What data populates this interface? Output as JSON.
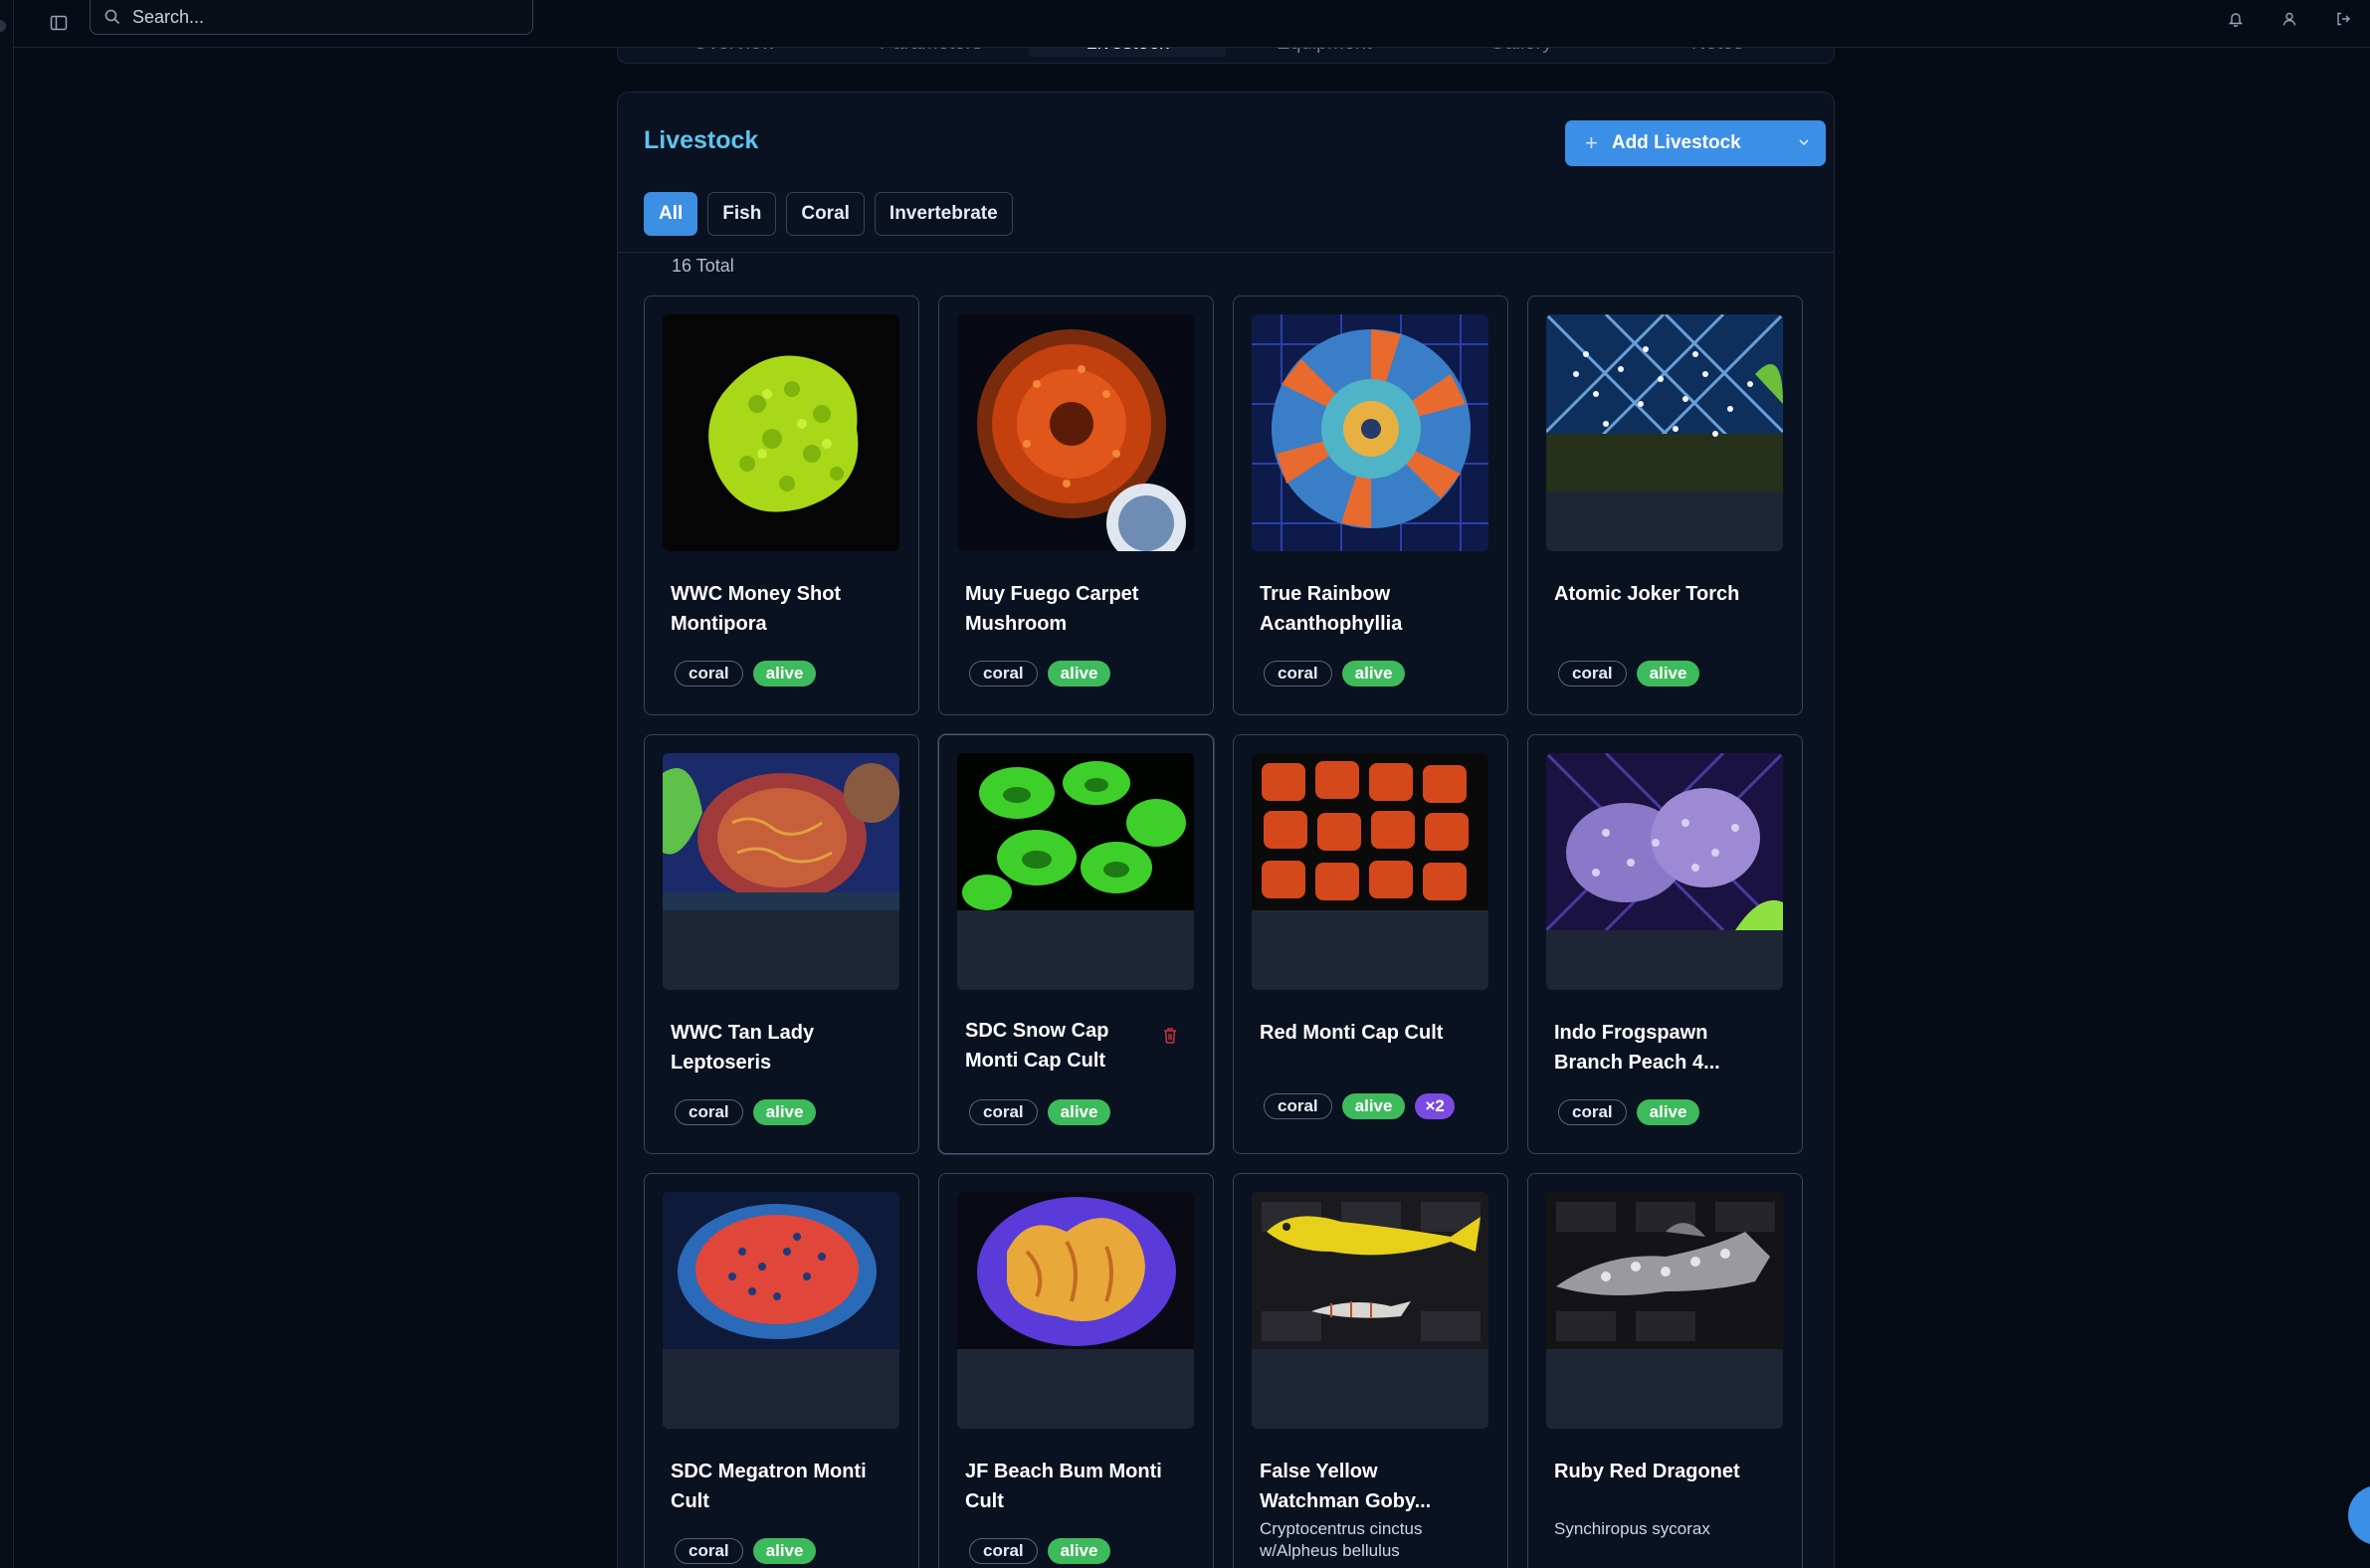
{
  "search": {
    "placeholder": "Search..."
  },
  "tabs": [
    {
      "label": "Overview",
      "active": false
    },
    {
      "label": "Parameters",
      "active": false
    },
    {
      "label": "Livestock",
      "active": true
    },
    {
      "label": "Equipment",
      "active": false
    },
    {
      "label": "Gallery",
      "active": false
    },
    {
      "label": "Notes",
      "active": false
    }
  ],
  "livestock": {
    "title": "Livestock",
    "add_label": "Add Livestock",
    "filters": [
      {
        "label": "All",
        "active": true
      },
      {
        "label": "Fish",
        "active": false
      },
      {
        "label": "Coral",
        "active": false
      },
      {
        "label": "Invertebrate",
        "active": false
      }
    ],
    "total_label": "16 Total",
    "items": [
      {
        "name": "WWC Money Shot Montipora",
        "type": "coral",
        "status": "alive"
      },
      {
        "name": "Muy Fuego Carpet Mushroom",
        "type": "coral",
        "status": "alive"
      },
      {
        "name": "True Rainbow Acanthophyllia",
        "type": "coral",
        "status": "alive"
      },
      {
        "name": "Atomic Joker Torch",
        "type": "coral",
        "status": "alive"
      },
      {
        "name": "WWC Tan Lady Leptoseris",
        "type": "coral",
        "status": "alive"
      },
      {
        "name": "SDC Snow Cap Monti Cap Cult",
        "type": "coral",
        "status": "alive"
      },
      {
        "name": "Red Monti Cap Cult",
        "type": "coral",
        "status": "alive",
        "quantity": "×2"
      },
      {
        "name": "Indo Frogspawn Branch Peach 4...",
        "type": "coral",
        "status": "alive"
      },
      {
        "name": "SDC Megatron Monti Cult",
        "type": "coral",
        "status": "alive"
      },
      {
        "name": "JF Beach Bum Monti Cult",
        "type": "coral",
        "status": "alive"
      },
      {
        "name": "False Yellow Watchman Goby...",
        "scientific": "Cryptocentrus cinctus w/Alpheus bellulus"
      },
      {
        "name": "Ruby Red Dragonet",
        "scientific": "Synchiropus sycorax"
      }
    ]
  },
  "colors": {
    "accent": "#3b8fe6",
    "title": "#5cc4ee",
    "alive": "#3dba5b",
    "quantity": "#7b4ae2",
    "background": "#060b16",
    "panel": "#0a1120"
  }
}
